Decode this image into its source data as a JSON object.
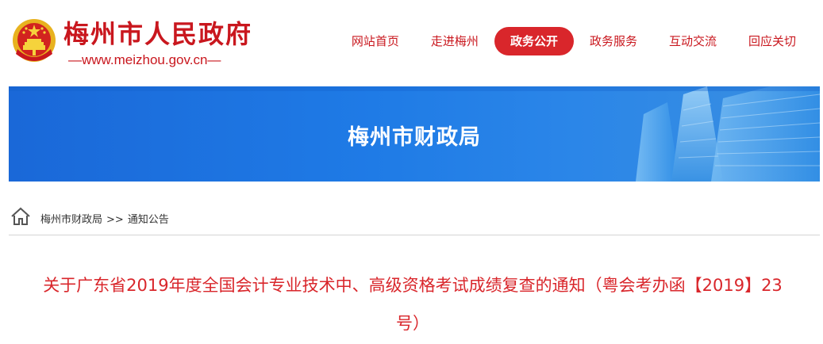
{
  "header": {
    "site_title": "梅州市人民政府",
    "site_url": "—www.meizhou.gov.cn—"
  },
  "nav": {
    "items": [
      {
        "label": "网站首页",
        "active": false
      },
      {
        "label": "走进梅州",
        "active": false
      },
      {
        "label": "政务公开",
        "active": true
      },
      {
        "label": "政务服务",
        "active": false
      },
      {
        "label": "互动交流",
        "active": false
      },
      {
        "label": "回应关切",
        "active": false
      }
    ]
  },
  "banner": {
    "title": "梅州市财政局"
  },
  "breadcrumb": {
    "items": [
      "梅州市财政局",
      "通知公告"
    ],
    "separator": ">>"
  },
  "article": {
    "title": "关于广东省2019年度全国会计专业技术中、高级资格考试成绩复查的通知（粤会考办函【2019】23号）"
  },
  "colors": {
    "brand_red": "#c9171e",
    "nav_active_bg": "#d9262b",
    "banner_blue": "#1f7be6"
  },
  "icons": {
    "emblem": "national-emblem-icon",
    "home": "home-icon"
  }
}
